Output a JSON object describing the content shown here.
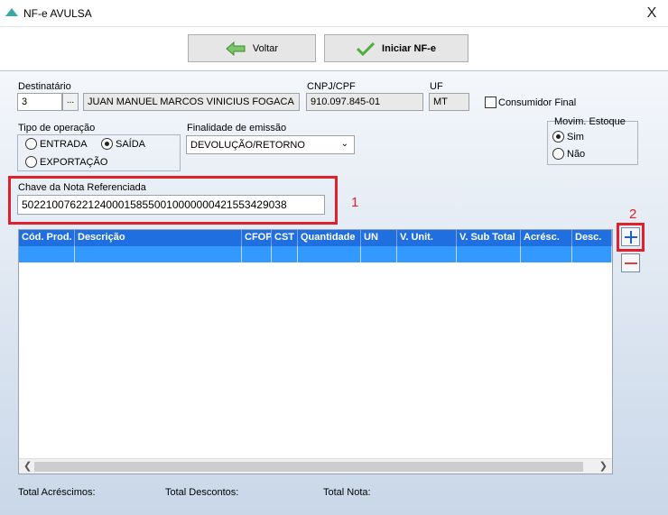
{
  "window": {
    "title": "NF-e AVULSA",
    "close_label": "X"
  },
  "toolbar": {
    "voltar_label": "Voltar",
    "iniciar_label": "Iniciar NF-e"
  },
  "destinatario": {
    "label": "Destinatário",
    "code": "3",
    "lookup_label": "...",
    "name": "JUAN MANUEL MARCOS VINICIUS FOGACA"
  },
  "cnpj": {
    "label": "CNPJ/CPF",
    "value": "910.097.845-01"
  },
  "uf": {
    "label": "UF",
    "value": "MT"
  },
  "consumidor_final": {
    "label": "Consumidor Final",
    "checked": false
  },
  "tipo_operacao": {
    "label": "Tipo de operação",
    "options": [
      "ENTRADA",
      "SAÍDA",
      "EXPORTAÇÃO"
    ],
    "selected": "SAÍDA"
  },
  "finalidade": {
    "label": "Finalidade de emissão",
    "value": "DEVOLUÇÃO/RETORNO"
  },
  "movim_estoque": {
    "label": "Movim. Estoque",
    "options": [
      "Sim",
      "Não"
    ],
    "selected": "Sim"
  },
  "chave": {
    "label": "Chave da Nota Referenciada",
    "value": "50221007622124000158550010000000421553429038"
  },
  "annotations": {
    "marker1": "1",
    "marker2": "2"
  },
  "grid": {
    "columns": [
      "Cód. Prod.",
      "Descrição",
      "CFOP",
      "CST",
      "Quantidade",
      "UN",
      "V. Unit.",
      "V. Sub Total",
      "Acrésc.",
      "Desc."
    ]
  },
  "totals": {
    "acrescimos_label": "Total Acréscimos:",
    "descontos_label": "Total Descontos:",
    "nota_label": "Total Nota:"
  },
  "colors": {
    "grid_header": "#1f6fe0",
    "grid_selected_row": "#3399ff",
    "annotation_red": "#e0202a"
  },
  "icons": [
    "app-logo-icon",
    "close-icon",
    "arrow-left-icon",
    "checkmark-icon",
    "ellipsis-icon",
    "chevron-down-icon",
    "plus-icon",
    "minus-icon"
  ]
}
